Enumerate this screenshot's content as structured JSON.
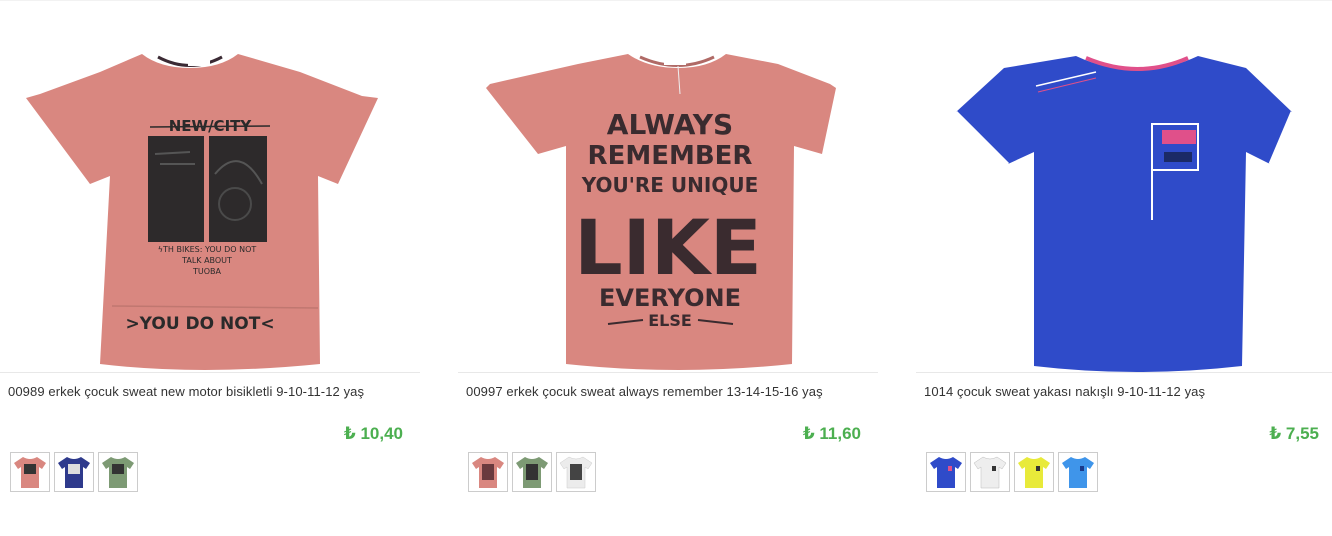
{
  "products": [
    {
      "title": "00989 erkek çocuk sweat new motor bisikletli 9-10-11-12 yaş",
      "price": "₺ 10,40",
      "shirt_color": "#d98780",
      "print": {
        "top": "NEW/CITY",
        "mid1": "ϟTH BIKES: YOU DO NOT",
        "mid2": "TALK ABOUT",
        "mid3": "TUOBA",
        "bottom": ">YOU DO NOT<"
      },
      "swatches": [
        {
          "color": "#d98780",
          "icon": "tshirt-icon"
        },
        {
          "color": "#2e3a8c",
          "icon": "tshirt-icon"
        },
        {
          "color": "#7d9a74",
          "icon": "tshirt-icon"
        }
      ]
    },
    {
      "title": "00997 erkek çocuk sweat always remember 13-14-15-16 yaş",
      "price": "₺ 11,60",
      "shirt_color": "#d98780",
      "print": {
        "l1": "ALWAYS",
        "l2": "REMEMBER",
        "l3": "YOU'RE UNIQUE",
        "l4": "LIKE",
        "l5": "EVERYONE",
        "l6": "ELSE"
      },
      "swatches": [
        {
          "color": "#d98780",
          "icon": "tshirt-icon"
        },
        {
          "color": "#7d9a74",
          "icon": "tshirt-icon"
        },
        {
          "color": "#ececec",
          "icon": "tshirt-icon"
        }
      ]
    },
    {
      "title": "1014 çocuk sweat yakası nakışlı 9-10-11-12 yaş",
      "price": "₺ 7,55",
      "shirt_color": "#2f4bc9",
      "swatches": [
        {
          "color": "#2f4bc9",
          "icon": "tshirt-icon"
        },
        {
          "color": "#eeeeee",
          "icon": "tshirt-icon"
        },
        {
          "color": "#e8ea3a",
          "icon": "tshirt-icon"
        },
        {
          "color": "#3f95ea",
          "icon": "tshirt-icon"
        }
      ]
    }
  ]
}
